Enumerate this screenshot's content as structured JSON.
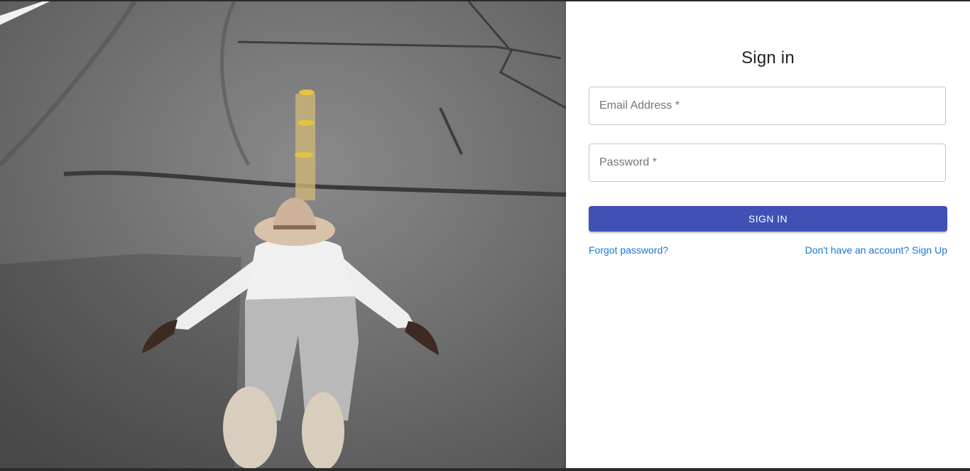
{
  "hero": {
    "image_alt": "Person lying face down on an asphalt road wearing a tan hat, white shirt and grey trousers",
    "colors": {
      "asphalt": "#6f6f6f",
      "lane_marker": "#d9b64a",
      "shirt": "#eeeeee",
      "pants": "#b8b8b8",
      "hat": "#d8c2aa"
    }
  },
  "form": {
    "title": "Sign in",
    "email": {
      "label": "Email Address",
      "required_mark": "*",
      "value": ""
    },
    "password": {
      "label": "Password",
      "required_mark": "*",
      "value": ""
    },
    "submit_label": "Sign In",
    "forgot_link": "Forgot password?",
    "signup_link": "Don't have an account? Sign Up"
  },
  "colors": {
    "primary": "#3f51b5",
    "link": "#1976d2",
    "panel_bg": "#ffffff"
  }
}
